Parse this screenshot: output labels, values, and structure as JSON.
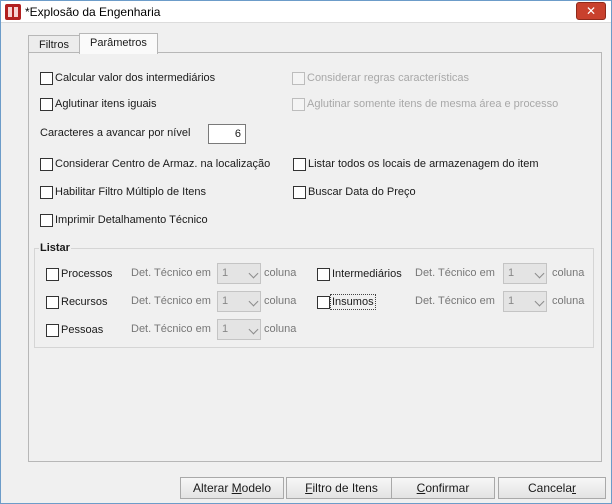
{
  "window": {
    "title": "*Explosão da Engenharia",
    "close_symbol": "✕"
  },
  "tabs": [
    {
      "label": "Filtros",
      "active": false
    },
    {
      "label": "Parâmetros",
      "active": true
    }
  ],
  "options": {
    "calcular_intermediarios": {
      "label": "Calcular valor dos intermediários",
      "checked": false,
      "enabled": true
    },
    "considerar_regras": {
      "label": "Considerar regras características",
      "checked": false,
      "enabled": false
    },
    "aglutinar_iguais": {
      "label": "Aglutinar itens iguais",
      "checked": false,
      "enabled": true
    },
    "aglutinar_mesma_area": {
      "label": "Aglutinar somente itens de mesma área e processo",
      "checked": false,
      "enabled": false
    },
    "caracteres_label": "Caracteres a avancar por nível",
    "caracteres_value": "6",
    "considerar_centro": {
      "label": "Considerar Centro de Armaz. na localização",
      "checked": false,
      "enabled": true
    },
    "listar_locais": {
      "label": "Listar todos os locais de armazenagem do item",
      "checked": false,
      "enabled": true
    },
    "habilitar_filtro": {
      "label": "Habilitar Filtro Múltiplo de Itens",
      "checked": false,
      "enabled": true
    },
    "buscar_data": {
      "label": "Buscar Data do Preço",
      "checked": false,
      "enabled": true
    },
    "imprimir_detalhamento": {
      "label": "Imprimir Detalhamento Técnico",
      "checked": false,
      "enabled": true
    }
  },
  "listar": {
    "title": "Listar",
    "det_label": "Det. Técnico em",
    "coluna_label": "coluna",
    "items": {
      "processos": {
        "label": "Processos",
        "checked": false,
        "column": "1"
      },
      "recursos": {
        "label": "Recursos",
        "checked": false,
        "column": "1"
      },
      "pessoas": {
        "label": "Pessoas",
        "checked": false,
        "column": "1"
      },
      "intermediarios": {
        "label": "Intermediários",
        "checked": false,
        "column": "1"
      },
      "insumos": {
        "label": "Insumos",
        "checked": false,
        "column": "1"
      }
    }
  },
  "buttons": {
    "alterar_modelo": {
      "pre": "Alterar ",
      "key": "M",
      "post": "odelo"
    },
    "filtro_itens": {
      "pre": "",
      "key": "F",
      "post": "iltro de Itens"
    },
    "confirmar": {
      "pre": "",
      "key": "C",
      "post": "onfirmar"
    },
    "cancelar": {
      "pre": "Cancela",
      "key": "r",
      "post": ""
    }
  }
}
